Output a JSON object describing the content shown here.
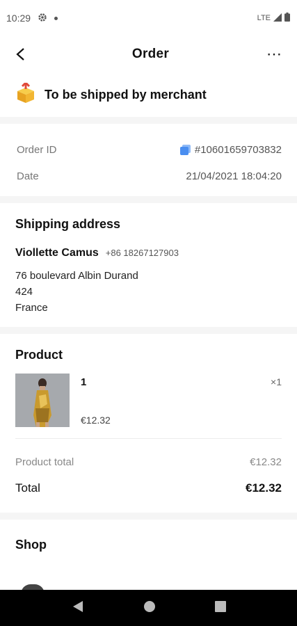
{
  "status_bar": {
    "time": "10:29",
    "network": "LTE"
  },
  "header": {
    "title": "Order"
  },
  "order_status": {
    "text": "To be shipped by merchant"
  },
  "order_info": {
    "order_id_label": "Order ID",
    "order_id_value": "#10601659703832",
    "date_label": "Date",
    "date_value": "21/04/2021 18:04:20"
  },
  "shipping": {
    "title": "Shipping address",
    "name": "Viollette Camus",
    "phone": "+86 18267127903",
    "address_lines": [
      "76 boulevard Albin Durand",
      "424",
      "France"
    ]
  },
  "product_section": {
    "title": "Product",
    "items": [
      {
        "name": "1",
        "price": "€12.32",
        "quantity": "×1"
      }
    ],
    "product_total_label": "Product total",
    "product_total_value": "€12.32",
    "total_label": "Total",
    "total_value": "€12.32"
  },
  "shop": {
    "title": "Shop"
  },
  "colors": {
    "accent_copy": "#4a8ef0",
    "box_icon": "#f2b632"
  }
}
